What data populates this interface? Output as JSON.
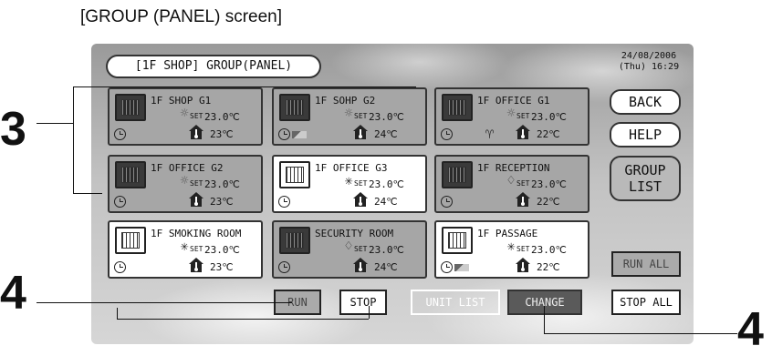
{
  "caption": "[GROUP (PANEL) screen]",
  "header": {
    "title": "[1F SHOP] GROUP(PANEL)",
    "date": "24/08/2006",
    "time": "(Thu) 16:29"
  },
  "set_label": "SET",
  "panels": [
    {
      "name": "1F SHOP G1",
      "set_temp": "23.0℃",
      "room_temp": "23℃",
      "mode": "sun"
    },
    {
      "name": "1F SOHP G2",
      "set_temp": "23.0℃",
      "room_temp": "24℃",
      "mode": "sun"
    },
    {
      "name": "1F OFFICE G1",
      "set_temp": "23.0℃",
      "room_temp": "22℃",
      "mode": "sun"
    },
    {
      "name": "1F OFFICE G2",
      "set_temp": "23.0℃",
      "room_temp": "23℃",
      "mode": "sun"
    },
    {
      "name": "1F OFFICE G3",
      "set_temp": "23.0℃",
      "room_temp": "24℃",
      "mode": "snow"
    },
    {
      "name": "1F RECEPTION",
      "set_temp": "23.0℃",
      "room_temp": "22℃",
      "mode": "drop"
    },
    {
      "name": "1F SMOKING ROOM",
      "set_temp": "23.0℃",
      "room_temp": "23℃",
      "mode": "snow"
    },
    {
      "name": "SECURITY ROOM",
      "set_temp": "23.0℃",
      "room_temp": "24℃",
      "mode": "drop"
    },
    {
      "name": "1F PASSAGE",
      "set_temp": "23.0℃",
      "room_temp": "22℃",
      "mode": "snow"
    }
  ],
  "side_buttons": {
    "back": "BACK",
    "help": "HELP",
    "group_list_1": "GROUP",
    "group_list_2": "LIST",
    "run_all": "RUN ALL",
    "stop_all": "STOP ALL"
  },
  "bottom_buttons": {
    "run": "RUN",
    "stop": "STOP",
    "unit_list": "UNIT LIST",
    "change": "CHANGE"
  },
  "callouts": {
    "top_left": "3",
    "bottom_left": "4",
    "bottom_right": "4"
  }
}
